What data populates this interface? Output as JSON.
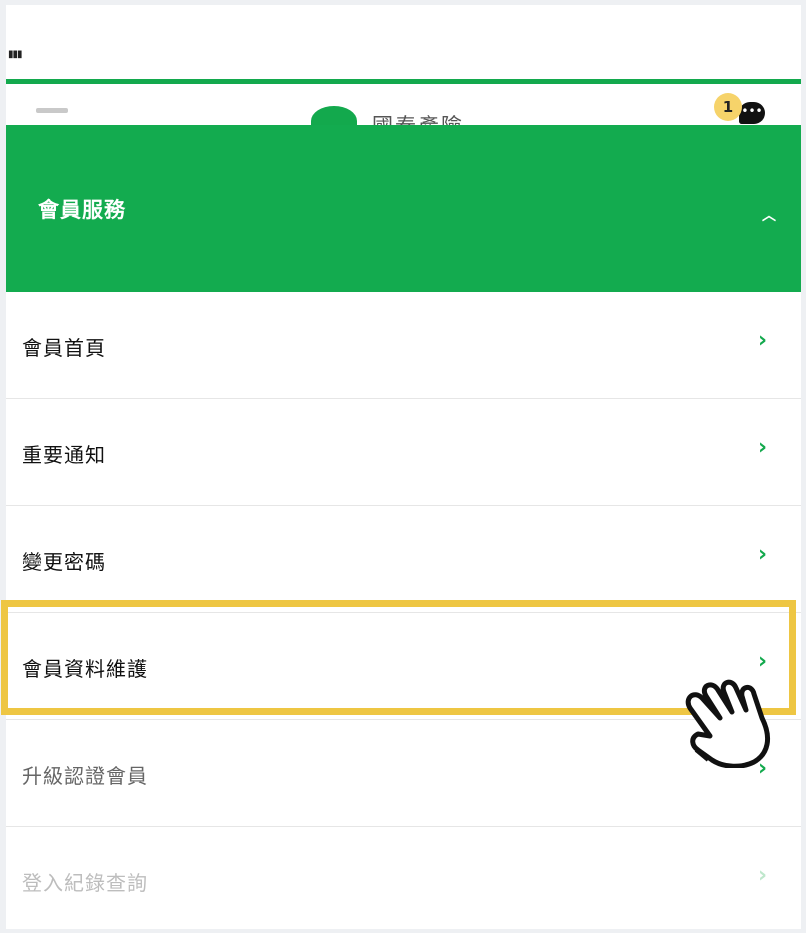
{
  "status_bar": {
    "signal_text": "▮▮▮"
  },
  "app_bar": {
    "logo_text": "國泰產險",
    "notification_count": "1",
    "chat_glyph": "•••"
  },
  "section": {
    "title": "會員服務"
  },
  "menu": {
    "items": [
      {
        "label": "會員首頁"
      },
      {
        "label": "重要通知"
      },
      {
        "label": "變更密碼"
      },
      {
        "label": "會員資料維護"
      },
      {
        "label": "升級認證會員"
      },
      {
        "label": "登入紀錄查詢"
      }
    ]
  },
  "icons": {
    "chevron": "chevron-right-icon",
    "caret": "caret-up-icon",
    "pointer": "hand-pointer-icon"
  },
  "colors": {
    "brand_green": "#13ab4f",
    "highlight": "#eec643",
    "badge": "#f6d36a"
  }
}
